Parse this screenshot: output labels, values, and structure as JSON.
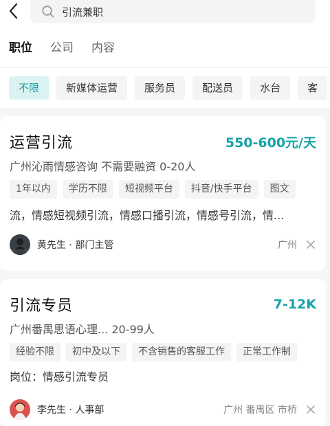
{
  "search": {
    "query": "引流兼职"
  },
  "tabs": [
    {
      "label": "职位"
    },
    {
      "label": "公司"
    },
    {
      "label": "内容"
    }
  ],
  "filters": [
    {
      "label": "不限"
    },
    {
      "label": "新媒体运营"
    },
    {
      "label": "服务员"
    },
    {
      "label": "配送员"
    },
    {
      "label": "水台"
    },
    {
      "label": "客"
    }
  ],
  "jobs": [
    {
      "title": "运营引流",
      "salary": "550-600元/天",
      "company": "广州沁雨情感咨询 不需要融资 0-20人",
      "tags": [
        "1年以内",
        "学历不限",
        "短视频平台",
        "抖音/快手平台",
        "图文"
      ],
      "description": "流，情感短视频引流，情感口播引流，情感号引流，情...",
      "recruiter": "黄先生 · 部门主管",
      "location": "广州"
    },
    {
      "title": "引流专员",
      "salary": "7-12K",
      "company": "广州番禺思语心理... 20-99人",
      "tags": [
        "经验不限",
        "初中及以下",
        "不含销售的客服工作",
        "正常工作制"
      ],
      "description": "岗位：情感引流专员",
      "recruiter": "李先生 · 人事部",
      "location": "广州 番禺区 市桥"
    }
  ],
  "colors": {
    "accent": "#16a3a8",
    "chip_active_bg": "#dbf2f2"
  },
  "icons": {
    "back": "chevron-left-icon",
    "search": "search-icon",
    "close": "close-icon"
  }
}
